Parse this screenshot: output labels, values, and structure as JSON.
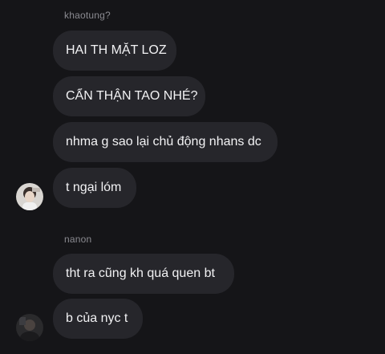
{
  "groups": [
    {
      "sender": "khaotung?",
      "messages": [
        "HAI TH MẶT LOZ",
        "CẨN THẬN TAO NHÉ?",
        "nhma g sao lại chủ động nhans dc",
        "t ngại lóm"
      ]
    },
    {
      "sender": "nanon",
      "messages": [
        "tht ra cũng kh quá quen bt",
        "b của nyc t"
      ]
    }
  ],
  "colors": {
    "background": "#151518",
    "bubble": "#26262b",
    "text": "#f2f2f4",
    "sender": "#8a8a90"
  }
}
